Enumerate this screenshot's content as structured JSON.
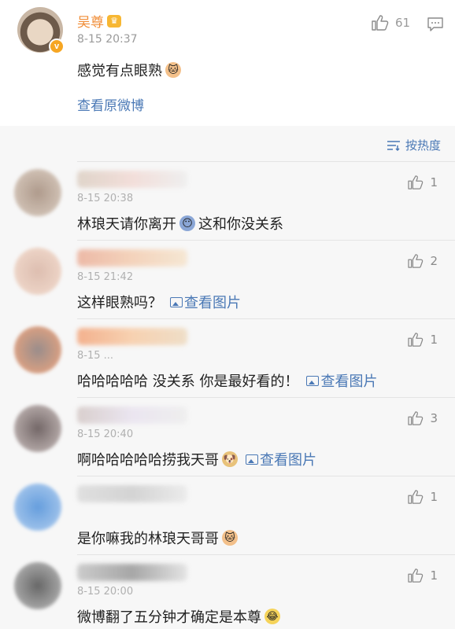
{
  "post": {
    "author": "吴尊",
    "verified_badge": "v",
    "time": "8-15 20:37",
    "like_count": "61",
    "text": "感觉有点眼熟",
    "view_original": "查看原微博"
  },
  "sort": {
    "label": "按热度"
  },
  "comments": [
    {
      "time": "8-15 20:38",
      "text_before": "林琅天请你离开",
      "text_after": "这和你没关系",
      "likes": "1",
      "pic_link": "",
      "colors": [
        "#a38b7a",
        "#d8c9bb"
      ]
    },
    {
      "time": "8-15 21:42",
      "text_before": "这样眼熟吗？",
      "text_after": "",
      "likes": "2",
      "pic_link": "查看图片",
      "colors": [
        "#e9a58c",
        "#f3c7a8"
      ]
    },
    {
      "time": "8-15 ...",
      "text_before": "哈哈哈哈哈 没关系 你是最好看的！",
      "text_after": "",
      "likes": "1",
      "pic_link": "查看图片",
      "colors": [
        "#f29a6b",
        "#f7c59a"
      ]
    },
    {
      "time": "8-15 20:40",
      "text_before": "啊哈哈哈哈哈捞我天哥",
      "text_after": "",
      "likes": "3",
      "pic_link": "查看图片",
      "colors": [
        "#7d6a6a",
        "#cfc2c0"
      ]
    },
    {
      "time": "",
      "text_before": "是你嘛我的林琅天哥哥",
      "text_after": "",
      "likes": "1",
      "pic_link": "",
      "colors": [
        "#4d8fd9",
        "#d8d8d8"
      ]
    },
    {
      "time": "8-15 20:00",
      "text_before": "微博翻了五分钟才确定是本尊",
      "text_after": "",
      "likes": "1",
      "pic_link": "",
      "colors": [
        "#6e6e6e",
        "#bdbdbd"
      ]
    }
  ],
  "icons": {
    "like": "thumbs-up-icon",
    "comment": "comment-icon",
    "sort": "sort-icon",
    "picture": "picture-icon"
  },
  "colors": {
    "accent": "#4a78b5",
    "author": "#f08c36",
    "badge": "#f6a623"
  }
}
